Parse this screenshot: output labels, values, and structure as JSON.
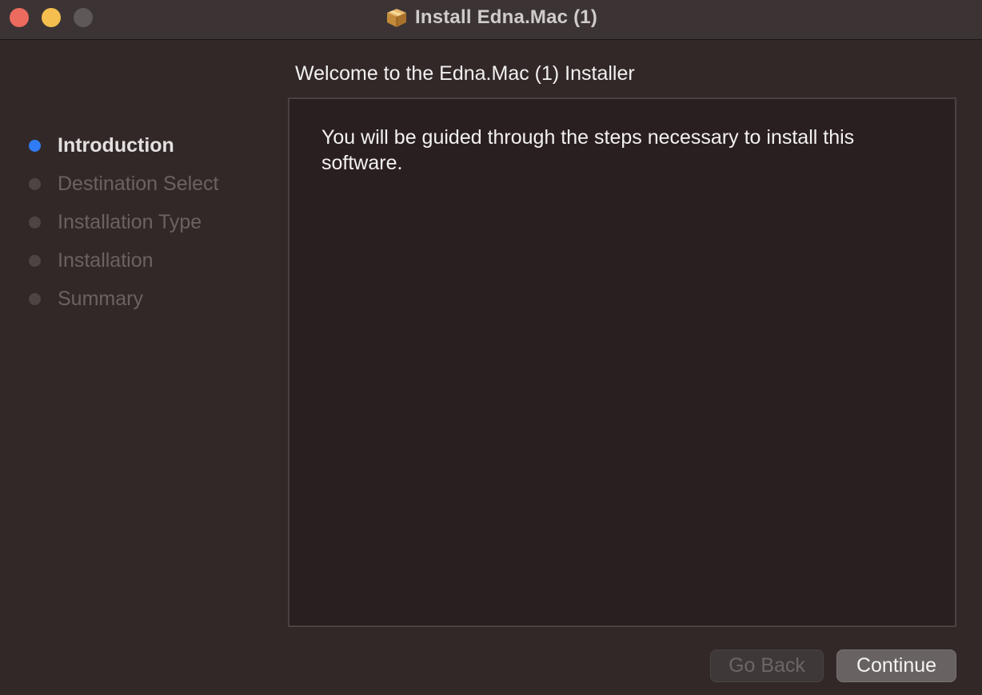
{
  "window": {
    "title": "Install Edna.Mac (1)",
    "title_icon": "package-icon"
  },
  "sidebar": {
    "steps": [
      {
        "label": "Introduction",
        "state": "active"
      },
      {
        "label": "Destination Select",
        "state": "pending"
      },
      {
        "label": "Installation Type",
        "state": "pending"
      },
      {
        "label": "Installation",
        "state": "pending"
      },
      {
        "label": "Summary",
        "state": "pending"
      }
    ]
  },
  "main": {
    "heading": "Welcome to the Edna.Mac (1) Installer",
    "body": "You will be guided through the steps necessary to install this software."
  },
  "buttons": {
    "go_back": "Go Back",
    "continue": "Continue"
  },
  "colors": {
    "accent": "#2f7cf6",
    "close": "#ec6a5e",
    "minimize": "#f4bf4f",
    "zoom_disabled": "#5f5858"
  }
}
